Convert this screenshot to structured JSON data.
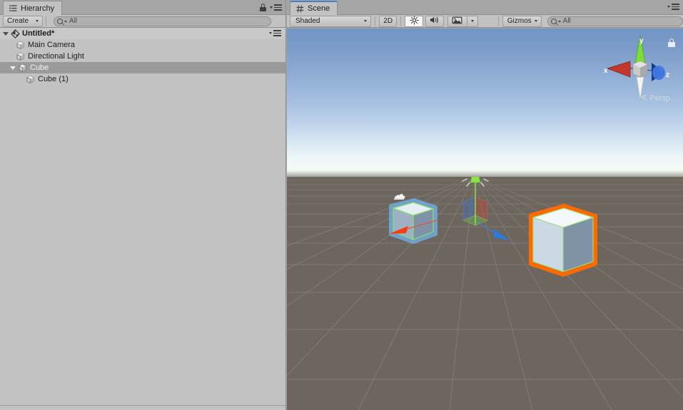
{
  "app": {
    "name": "Unity Editor",
    "theme_bg": "#c2c2c2",
    "accent": "#4b7fc4"
  },
  "hierarchy": {
    "tab_label": "Hierarchy",
    "tab_icon": "hierarchy-list-icon",
    "lock_icon": "lock-icon",
    "menu_icon": "panel-menu-icon",
    "toolbar": {
      "create_label": "Create",
      "create_icon": "chevron-down-icon",
      "search_value": "",
      "search_placeholder": "All",
      "search_icon": "search-icon"
    },
    "scene_menu_icon": "scene-context-menu-icon",
    "tree": [
      {
        "label": "Untitled*",
        "depth": 0,
        "icon": "unity-scene-icon",
        "twisty": "expanded",
        "selected": false,
        "bold": true
      },
      {
        "label": "Main Camera",
        "depth": 1,
        "icon": "gameobject-cube-icon",
        "twisty": "none",
        "selected": false,
        "bold": false
      },
      {
        "label": "Directional Light",
        "depth": 1,
        "icon": "gameobject-cube-icon",
        "twisty": "none",
        "selected": false,
        "bold": false
      },
      {
        "label": "Cube",
        "depth": 1,
        "icon": "gameobject-cube-icon",
        "twisty": "expanded",
        "selected": true,
        "bold": false
      },
      {
        "label": "Cube (1)",
        "depth": 2,
        "icon": "gameobject-cube-icon",
        "twisty": "none",
        "selected": false,
        "bold": false
      }
    ]
  },
  "scene": {
    "tab_label": "Scene",
    "tab_icon": "scene-grid-icon",
    "menu_icon": "panel-menu-icon",
    "toolbar": {
      "draw_mode": "Shaded",
      "draw_mode_icon": "chevron-down-icon",
      "toggle_2d": "2D",
      "lighting_icon": "sun-icon",
      "lighting_on": true,
      "audio_icon": "speaker-icon",
      "audio_on": false,
      "effects_icon": "image-effects-icon",
      "effects_dropdown_icon": "chevron-down-icon",
      "gizmos_label": "Gizmos",
      "gizmos_icon": "chevron-down-icon",
      "search_value": "",
      "search_placeholder": "All",
      "search_icon": "search-icon"
    },
    "view_gizmo": {
      "axis_x": "x",
      "axis_y": "y",
      "axis_z": "z",
      "projection_label": "Persp",
      "projection_prefix_icon": "left-arrow-icon",
      "lock_icon": "lock-icon",
      "color_x": "#c0392b",
      "color_y": "#7ddb3a",
      "color_z": "#2b5fc4"
    },
    "objects": [
      {
        "name": "Cube (1)",
        "kind": "child-cube",
        "state": "child-of-selection",
        "outline_color": "#5fa8e8"
      },
      {
        "name": "Cube",
        "kind": "cube",
        "state": "selected",
        "outline_color": "#ff6a00"
      },
      {
        "name": "Directional Light",
        "kind": "light-gizmo",
        "state": "normal",
        "outline_color": "#8ee04c"
      },
      {
        "name": "Main Camera",
        "kind": "camera-gizmo",
        "state": "normal",
        "outline_color": "#ffffff"
      },
      {
        "name": "Move Tool Handle",
        "kind": "transform-gizmo",
        "state": "active",
        "outline_color": "#ffffff"
      }
    ],
    "sky_top_color": "#7295c4",
    "sky_horizon_color": "#eef7f7",
    "ground_color": "#6c665f",
    "grid_color": "#8b857e"
  }
}
